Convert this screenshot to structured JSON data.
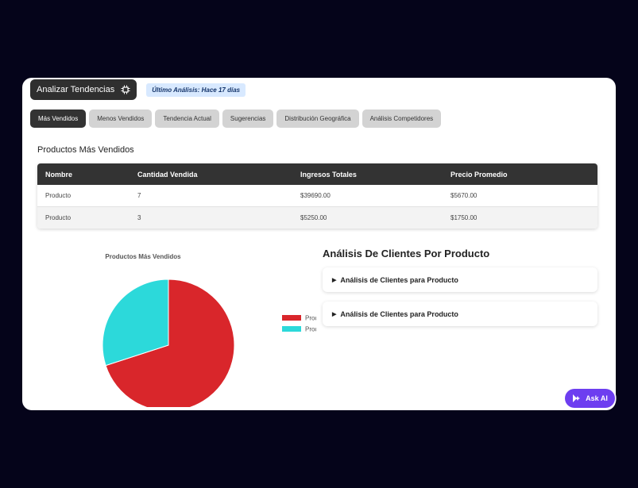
{
  "toolbar": {
    "analyze_label": "Analizar Tendencias",
    "last_analysis": "Último Análisis: Hace 17 días"
  },
  "tabs": [
    {
      "label": "Más Vendidos",
      "active": true
    },
    {
      "label": "Menos Vendidos",
      "active": false
    },
    {
      "label": "Tendencia Actual",
      "active": false
    },
    {
      "label": "Sugerencias",
      "active": false
    },
    {
      "label": "Distribución Geográfica",
      "active": false
    },
    {
      "label": "Análisis Competidores",
      "active": false
    }
  ],
  "section": {
    "title": "Productos Más Vendidos"
  },
  "table": {
    "headers": [
      "Nombre",
      "Cantidad Vendida",
      "Ingresos Totales",
      "Precio Promedio"
    ],
    "rows": [
      [
        "Producto",
        "7",
        "$39690.00",
        "$5670.00"
      ],
      [
        "Producto",
        "3",
        "$5250.00",
        "$1750.00"
      ]
    ]
  },
  "chart_data": {
    "type": "pie",
    "title": "Productos Más Vendidos",
    "categories": [
      "Producto",
      "Producto"
    ],
    "values": [
      7,
      3
    ],
    "colors": [
      "#d9262b",
      "#2cd9da"
    ],
    "legend": "right"
  },
  "customers": {
    "title": "Análisis De Clientes Por Producto",
    "items": [
      "Análisis de Clientes para Producto",
      "Análisis de Clientes para Producto"
    ]
  },
  "ask_ai": {
    "label": "Ask AI"
  },
  "colors": {
    "background": "#05041a",
    "dark": "#333333",
    "accent": "#6d3ef0",
    "badge": "#d8e9ff"
  }
}
